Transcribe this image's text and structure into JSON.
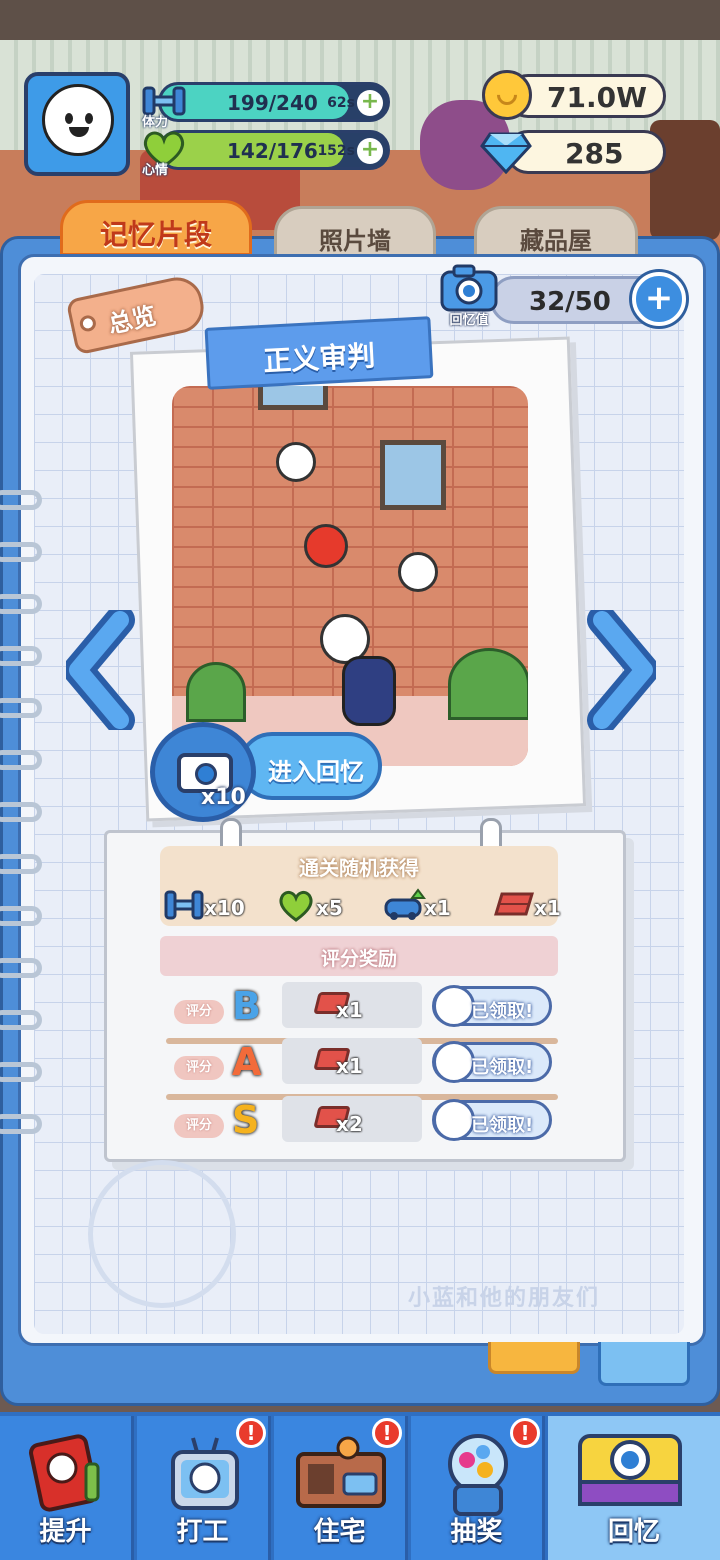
{
  "hud": {
    "stamina": {
      "icon": "dumbbell-icon",
      "label": "体力",
      "value": "199/240",
      "timer": "62s",
      "plus": "+",
      "fill": 0.83,
      "color": "#4cd3c2"
    },
    "mood": {
      "icon": "heart-icon",
      "label": "心情",
      "value": "142/176",
      "timer": "152s",
      "plus": "+",
      "fill": 0.81,
      "color": "#9bd14a"
    },
    "gold": {
      "icon": "coin-icon",
      "value": "71.0W"
    },
    "diamond": {
      "icon": "diamond-icon",
      "value": "285"
    }
  },
  "tabs": [
    {
      "label": "记忆片段",
      "active": true
    },
    {
      "label": "照片墙",
      "active": false
    },
    {
      "label": "藏品屋",
      "active": false
    }
  ],
  "overview_label": "总览",
  "memory": {
    "icon_label": "回忆值",
    "count": "32/50",
    "plus": "+"
  },
  "photo": {
    "title": "正义审判"
  },
  "enter": {
    "label": "进入回忆",
    "cost": "x10"
  },
  "random_drops": {
    "title": "通关随机获得",
    "items": [
      {
        "icon": "dumbbell-icon",
        "count": "x10"
      },
      {
        "icon": "heart-icon",
        "count": "x5"
      },
      {
        "icon": "car-upgrade-icon",
        "count": "x1"
      },
      {
        "icon": "brick-icon",
        "count": "x1"
      }
    ]
  },
  "score_rewards": {
    "title": "评分奖励",
    "rows": [
      {
        "tag": "评分",
        "grade": "B",
        "grade_color": "#4aa3e8",
        "reward_icon": "brick-icon",
        "reward_count": "x1",
        "status": "已领取!"
      },
      {
        "tag": "评分",
        "grade": "A",
        "grade_color": "#f26b3a",
        "reward_icon": "brick-icon",
        "reward_count": "x1",
        "status": "已领取!"
      },
      {
        "tag": "评分",
        "grade": "S",
        "grade_color": "#f5b21e",
        "reward_icon": "brick-icon",
        "reward_count": "x2",
        "status": "已领取!"
      }
    ]
  },
  "watermark": "小蓝和他的朋友们",
  "nav": [
    {
      "label": "提升",
      "icon": "book-icon",
      "badge": ""
    },
    {
      "label": "打工",
      "icon": "work-robot-icon",
      "badge": "!"
    },
    {
      "label": "住宅",
      "icon": "house-icon",
      "badge": "!"
    },
    {
      "label": "抽奖",
      "icon": "gacha-machine-icon",
      "badge": "!"
    },
    {
      "label": "回忆",
      "icon": "camera-icon",
      "badge": ""
    }
  ]
}
